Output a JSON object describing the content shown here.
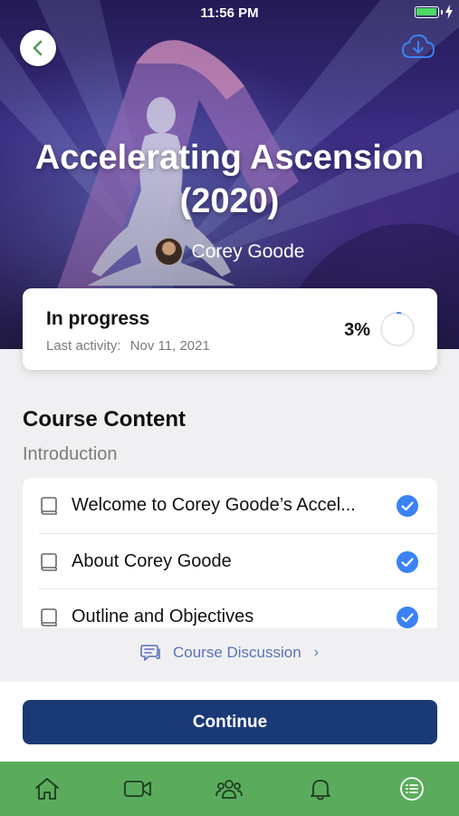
{
  "status_bar": {
    "time": "11:56 PM",
    "battery_level": 1.0
  },
  "hero": {
    "title_line1": "Accelerating Ascension",
    "title_line2": "(2020)",
    "author": "Corey Goode",
    "colors": {
      "accent_purple": "#3b2d86",
      "figure": "#d6d6ea"
    }
  },
  "progress": {
    "status": "In progress",
    "last_activity_label": "Last activity:",
    "last_activity_date": "Nov 11, 2021",
    "percent_text": "3%",
    "percent_value": 0.03,
    "ring_color": "#3b82f6"
  },
  "content": {
    "section_title": "Course Content",
    "module_title": "Introduction",
    "lessons": [
      {
        "title": "Welcome to Corey Goode’s Accel...",
        "completed": true
      },
      {
        "title": "About Corey Goode",
        "completed": true
      },
      {
        "title": "Outline and Objectives",
        "completed": true
      }
    ]
  },
  "discussion": {
    "label": "Course Discussion",
    "chevron": "›"
  },
  "actions": {
    "continue_label": "Continue",
    "continue_color": "#1a3a76"
  },
  "tab_bar": {
    "color": "#5aac5c",
    "tabs": [
      {
        "icon": "home-icon"
      },
      {
        "icon": "video-icon"
      },
      {
        "icon": "community-icon"
      },
      {
        "icon": "bell-icon"
      },
      {
        "icon": "menu-list-icon"
      }
    ]
  }
}
